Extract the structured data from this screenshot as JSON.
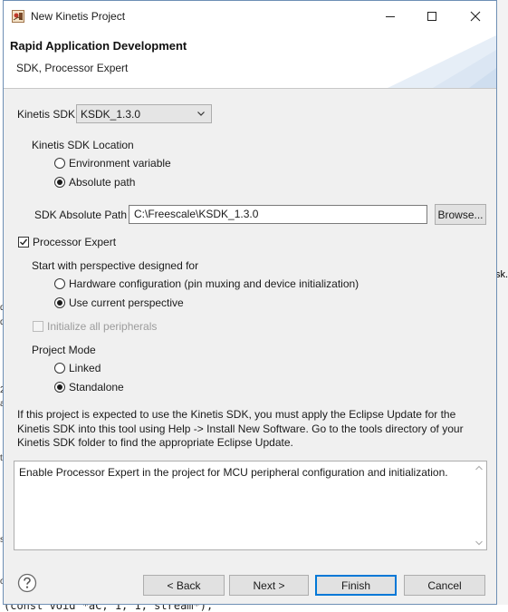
{
  "window": {
    "title": "New Kinetis Project"
  },
  "background": {
    "right_fragment": "sk.",
    "left_glyphs": [
      "d",
      "d",
      "2",
      "a",
      "t",
      "s",
      "o"
    ],
    "bottom_code": "(const void *aC, 1, 1, stream*);"
  },
  "banner": {
    "title": "Rapid Application Development",
    "subtitle": "SDK, Processor Expert"
  },
  "sdk": {
    "label": "Kinetis SDK",
    "selected": "KSDK_1.3.0",
    "location_label": "Kinetis SDK Location",
    "location_options": [
      {
        "label": "Environment variable",
        "selected": false
      },
      {
        "label": "Absolute path",
        "selected": true
      }
    ],
    "abs_path_label": "SDK Absolute Path",
    "abs_path_value": "C:\\Freescale\\KSDK_1.3.0",
    "browse_label": "Browse..."
  },
  "processor_expert": {
    "label": "Processor Expert",
    "checked": true,
    "perspective_label": "Start with perspective designed for",
    "perspective_options": [
      {
        "label": "Hardware configuration (pin muxing and device initialization)",
        "selected": false
      },
      {
        "label": "Use current perspective",
        "selected": true
      }
    ],
    "init_peripherals_label": "Initialize all peripherals",
    "init_peripherals_checked": false
  },
  "project_mode": {
    "label": "Project Mode",
    "options": [
      {
        "label": "Linked",
        "selected": false
      },
      {
        "label": "Standalone",
        "selected": true
      }
    ]
  },
  "info_text": "If this project is expected to use the Kinetis SDK, you must apply the Eclipse Update for the Kinetis SDK into this tool using Help -> Install New Software. Go to the tools directory of your Kinetis SDK folder to find the appropriate Eclipse Update.",
  "description": "Enable Processor Expert in the project for MCU peripheral configuration and initialization.",
  "footer": {
    "back_label": "< Back",
    "next_label": "Next >",
    "finish_label": "Finish",
    "cancel_label": "Cancel"
  },
  "colors": {
    "accent": "#0078d7",
    "window_border": "#6e8fb5",
    "dialog_bg": "#f0f0f0"
  }
}
